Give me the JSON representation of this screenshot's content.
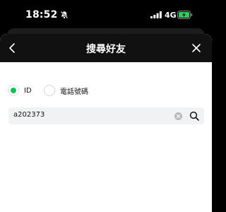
{
  "status_bar": {
    "time": "18:52",
    "network": "4G",
    "icons": [
      "bell-slash-icon",
      "signal-bars-icon",
      "battery-charging-icon"
    ],
    "battery_color": "#34c759"
  },
  "nav": {
    "title": "搜尋好友",
    "back_icon": "chevron-left-icon",
    "close_icon": "close-icon"
  },
  "search_type": {
    "options": [
      {
        "label": "ID",
        "selected": true
      },
      {
        "label": "電話號碼",
        "selected": false
      }
    ],
    "accent_color": "#06c755"
  },
  "search": {
    "value": "a202373",
    "clear_icon": "clear-circle-icon",
    "search_icon": "search-icon"
  }
}
